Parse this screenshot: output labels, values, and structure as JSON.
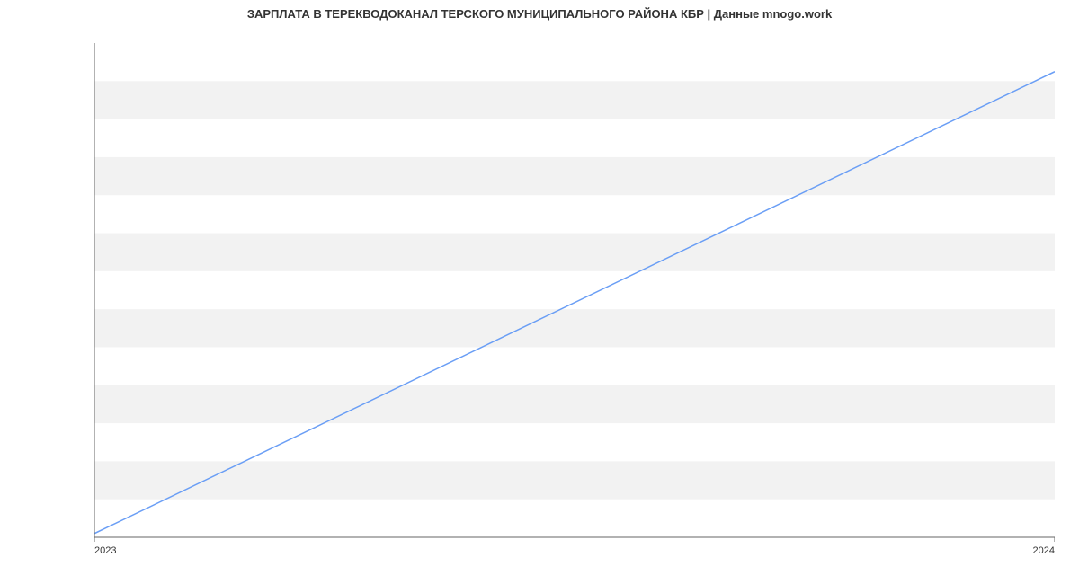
{
  "title": "ЗАРПЛАТА В ТЕРЕКВОДОКАНАЛ ТЕРСКОГО МУНИЦИПАЛЬНОГО РАЙОНА КБР | Данные mnogo.work",
  "chart_data": {
    "type": "line",
    "x": [
      2023,
      2024
    ],
    "values": [
      19220,
      21650
    ],
    "title": "ЗАРПЛАТА В ТЕРЕКВОДОКАНАЛ ТЕРСКОГО МУНИЦИПАЛЬНОГО РАЙОНА КБР | Данные mnogo.work",
    "xlabel": "",
    "ylabel": "",
    "yticks": [
      19200,
      19400,
      19600,
      19800,
      20000,
      20200,
      20400,
      20600,
      20800,
      21000,
      21200,
      21400,
      21600,
      21800
    ],
    "xticks": [
      2023,
      2024
    ],
    "ylim": [
      19200,
      21800
    ],
    "xlim": [
      2023,
      2024
    ],
    "grid": true
  }
}
